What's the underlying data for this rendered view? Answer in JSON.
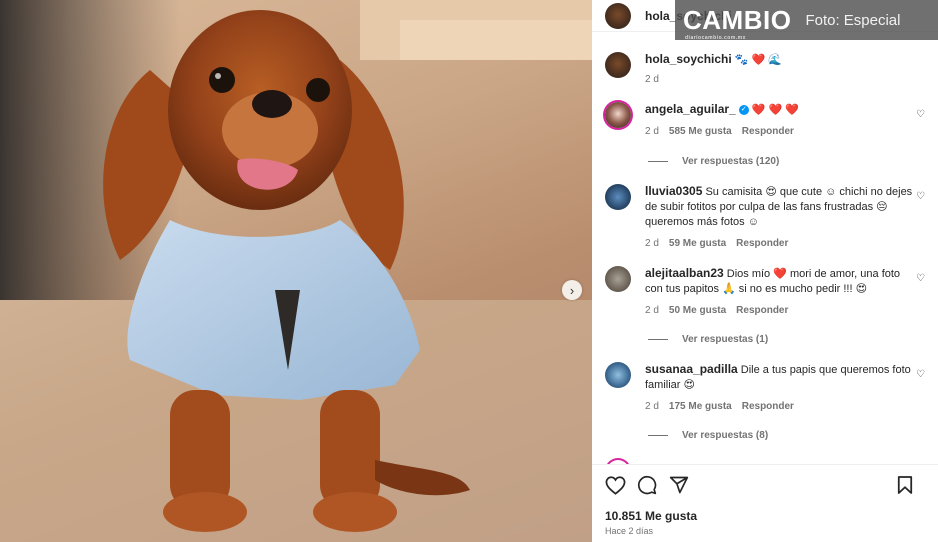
{
  "watermark": {
    "logo": "CAMBIO",
    "logo_sub": "diariocambio.com.mx",
    "credit": "Foto: Especial"
  },
  "header": {
    "username": "hola_soychichi"
  },
  "caption": {
    "username": "hola_soychichi",
    "emojis": "🐾 ❤️ 🌊",
    "time": "2 d"
  },
  "comments": [
    {
      "username": "angela_aguilar_",
      "verified": true,
      "text": "❤️ ❤️ ❤️",
      "time": "2 d",
      "likes": "585 Me gusta",
      "reply": "Responder",
      "view_replies": "Ver respuestas (120)"
    },
    {
      "username": "lluvia0305",
      "text": "Su camisita 😍 que cute ☺ chichi no dejes de subir fotitos por culpa de las fans frustradas 😔 queremos más fotos ☺",
      "time": "2 d",
      "likes": "59 Me gusta",
      "reply": "Responder",
      "view_replies": ""
    },
    {
      "username": "alejitaalban23",
      "text": "Dios mío ❤️ mori de amor, una foto con tus papitos 🙏 si no es mucho pedir !!! 😍",
      "time": "2 d",
      "likes": "50 Me gusta",
      "reply": "Responder",
      "view_replies": "Ver respuestas (1)"
    },
    {
      "username": "susanaa_padilla",
      "text": "Dile a tus papis que queremos foto familiar 😍",
      "time": "2 d",
      "likes": "175 Me gusta",
      "reply": "Responder",
      "view_replies": "Ver respuestas (8)"
    }
  ],
  "footer": {
    "likes": "10.851 Me gusta",
    "posted": "Hace 2 días"
  },
  "icons": {
    "like": "heart-outline-icon",
    "comment": "comment-bubble-icon",
    "share": "send-icon",
    "save": "bookmark-icon",
    "next": "chevron-right-icon",
    "verified": "verified-badge-icon"
  },
  "colors": {
    "link_pink": "#d6249f",
    "heart_red": "#ed4956",
    "verified_blue": "#0095f6",
    "muted": "#737373"
  }
}
